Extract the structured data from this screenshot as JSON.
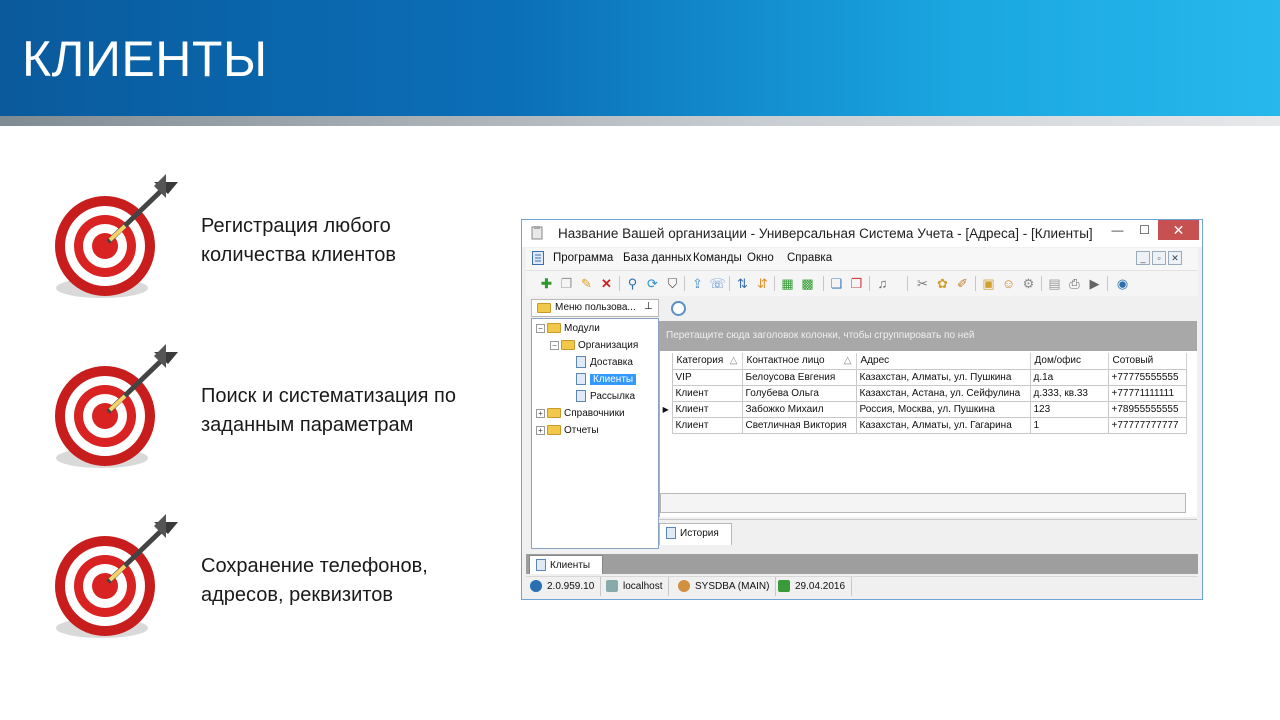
{
  "slide": {
    "title": "КЛИЕНТЫ",
    "bullets": [
      {
        "line1": "Регистрация любого",
        "line2": "количества клиентов"
      },
      {
        "line1": "Поиск и систематизация по",
        "line2": "заданным параметрам"
      },
      {
        "line1": "Сохранение телефонов,",
        "line2": "адресов, реквизитов"
      }
    ]
  },
  "app": {
    "title": "Название Вашей организации - Универсальная Система Учета - [Адреса] - [Клиенты]",
    "window_buttons": {
      "minimize": "—",
      "maximize": "☐",
      "close": "✕"
    },
    "menu": [
      "Программа",
      "База данных",
      "Команды",
      "Окно",
      "Справка"
    ],
    "mdi_buttons": {
      "minimize": "_",
      "restore": "▫",
      "close": "✕"
    },
    "toolbar_icons": [
      "add-icon",
      "copy-icon",
      "edit-icon",
      "delete-icon",
      "search-icon",
      "refresh-icon",
      "filter-icon",
      "export-icon",
      "comment-icon",
      "sort-up-icon",
      "sort-down-icon",
      "excel-import-icon",
      "excel-export-icon",
      "new-window-icon",
      "close-window-icon",
      "sound-icon",
      "tools-icon",
      "paint-icon",
      "note-icon",
      "lock-icon",
      "users-icon",
      "settings-icon",
      "calendar-icon",
      "print-icon",
      "play-icon",
      "help-icon"
    ],
    "nav": {
      "header": "Меню пользова...",
      "pin": "⊥",
      "tree": [
        {
          "label": "Модули",
          "level": 0,
          "type": "folder",
          "expander": "−"
        },
        {
          "label": "Организация",
          "level": 1,
          "type": "folder",
          "expander": "−"
        },
        {
          "label": "Доставка",
          "level": 2,
          "type": "doc"
        },
        {
          "label": "Клиенты",
          "level": 2,
          "type": "doc",
          "selected": true
        },
        {
          "label": "Рассылка",
          "level": 2,
          "type": "doc"
        },
        {
          "label": "Справочники",
          "level": 0,
          "type": "folder",
          "expander": "+"
        },
        {
          "label": "Отчеты",
          "level": 0,
          "type": "folder",
          "expander": "+"
        }
      ]
    },
    "group_panel_text": "Перетащите сюда заголовок колонки, чтобы сгруппировать по ней",
    "grid": {
      "columns": [
        "Категория",
        "Контактное лицо",
        "Адрес",
        "Дом/офис",
        "Сотовый"
      ],
      "sort_marks": [
        "△",
        "△",
        "",
        "",
        ""
      ],
      "rows": [
        [
          "VIP",
          "Белоусова Евгения",
          "Казахстан, Алматы, ул. Пушкина",
          "д.1а",
          "+77775555555"
        ],
        [
          "Клиент",
          "Голубева Ольга",
          "Казахстан, Астана, ул. Сейфулина",
          "д.333, кв.33",
          "+77771111111"
        ],
        [
          "Клиент",
          "Забожко Михаил",
          "Россия, Москва, ул. Пушкина",
          "123",
          "+78955555555"
        ],
        [
          "Клиент",
          "Светличная Виктория",
          "Казахстан, Алматы, ул. Гагарина",
          "1",
          "+77777777777"
        ]
      ],
      "current_row_marker": "▶"
    },
    "history_tab": "История",
    "bottom_tab": "Клиенты",
    "status": {
      "version": "2.0.959.10",
      "host": "localhost",
      "user": "SYSDBA (MAIN)",
      "date": "29.04.2016"
    },
    "colors": {
      "title_gradient_start": "#0a5a9c",
      "title_gradient_end": "#27b8ec",
      "selection": "#3399ff",
      "close_button": "#c75050"
    }
  }
}
